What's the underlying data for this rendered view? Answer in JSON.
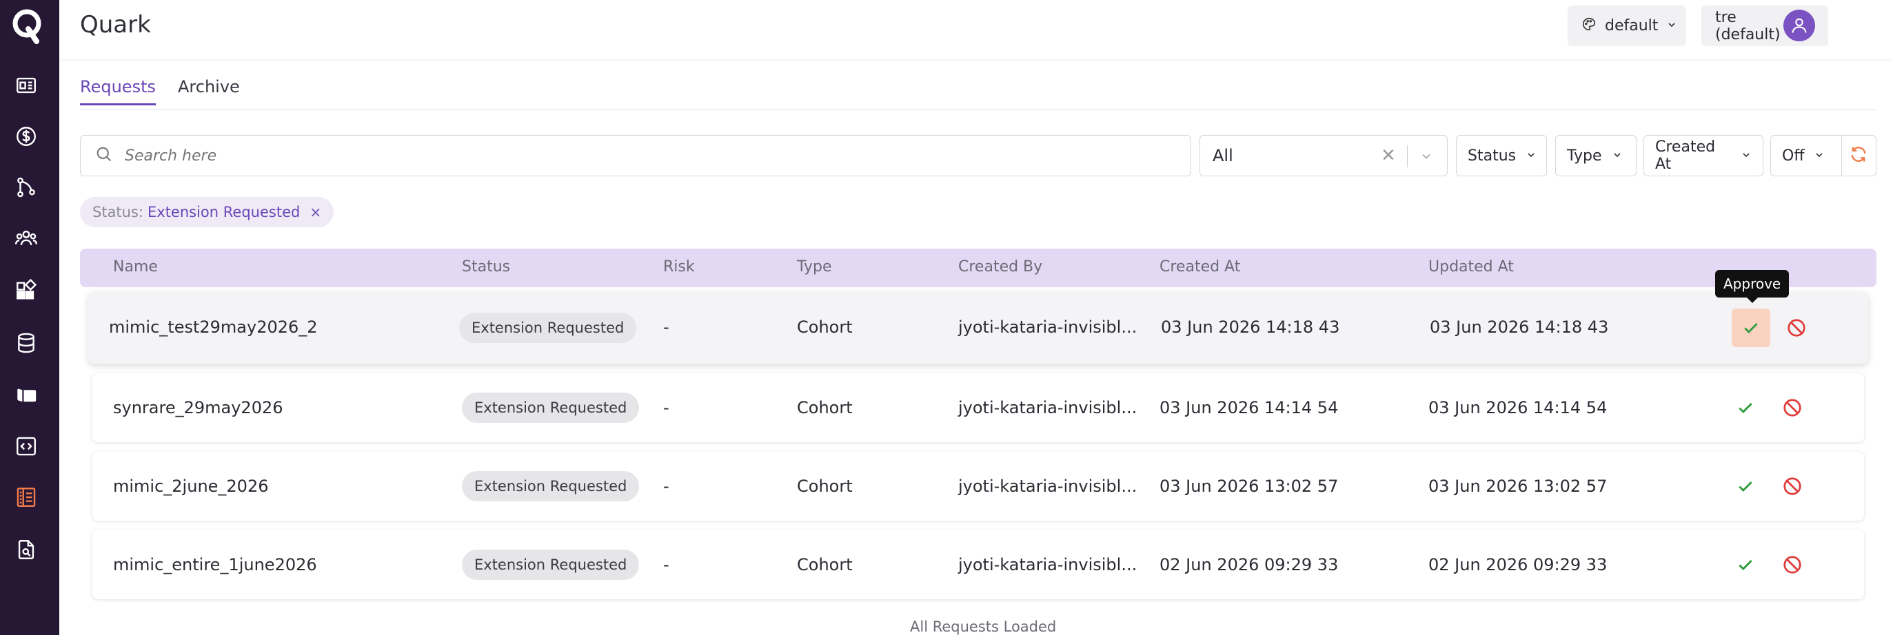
{
  "app": {
    "title": "Quark"
  },
  "header": {
    "theme_select": "default",
    "tenant_select": "tre (default)"
  },
  "tabs": [
    {
      "label": "Requests",
      "active": true
    },
    {
      "label": "Archive",
      "active": false
    }
  ],
  "filters": {
    "search_placeholder": "Search here",
    "scope_select": "All",
    "status_label": "Status",
    "type_label": "Type",
    "created_at_label": "Created At",
    "off_label": "Off"
  },
  "active_filter": {
    "key": "Status:",
    "value": "Extension Requested",
    "remove": "×"
  },
  "table": {
    "columns": [
      "Name",
      "Status",
      "Risk",
      "Type",
      "Created By",
      "Created At",
      "Updated At"
    ],
    "rows": [
      {
        "name": "mimic_test29may2026_2",
        "status": "Extension Requested",
        "risk": "-",
        "type": "Cohort",
        "created_by": "jyoti-kataria-invisibl...",
        "created_at": "03 Jun 2026 14:18 43",
        "updated_at": "03 Jun 2026 14:18 43"
      },
      {
        "name": "synrare_29may2026",
        "status": "Extension Requested",
        "risk": "-",
        "type": "Cohort",
        "created_by": "jyoti-kataria-invisibl...",
        "created_at": "03 Jun 2026 14:14 54",
        "updated_at": "03 Jun 2026 14:14 54"
      },
      {
        "name": "mimic_2june_2026",
        "status": "Extension Requested",
        "risk": "-",
        "type": "Cohort",
        "created_by": "jyoti-kataria-invisibl...",
        "created_at": "03 Jun 2026 13:02 57",
        "updated_at": "03 Jun 2026 13:02 57"
      },
      {
        "name": "mimic_entire_1june2026",
        "status": "Extension Requested",
        "risk": "-",
        "type": "Cohort",
        "created_by": "jyoti-kataria-invisibl...",
        "created_at": "02 Jun 2026 09:29 33",
        "updated_at": "02 Jun 2026 09:29 33"
      }
    ]
  },
  "tooltip": {
    "text": "Approve"
  },
  "footer": {
    "text": "All Requests Loaded"
  },
  "icons": {
    "sidebar": [
      "dashboard-icon",
      "billing-icon",
      "workflow-icon",
      "users-icon",
      "apps-icon",
      "database-icon",
      "projects-icon",
      "code-icon",
      "requests-icon",
      "audit-icon"
    ]
  },
  "colors": {
    "sidebar_bg": "#261735",
    "accent": "#6a46b8",
    "active_nav": "#f07b48",
    "approve": "#2e9c3a",
    "reject": "#e03b3b",
    "table_header": "#e3d9f4"
  }
}
